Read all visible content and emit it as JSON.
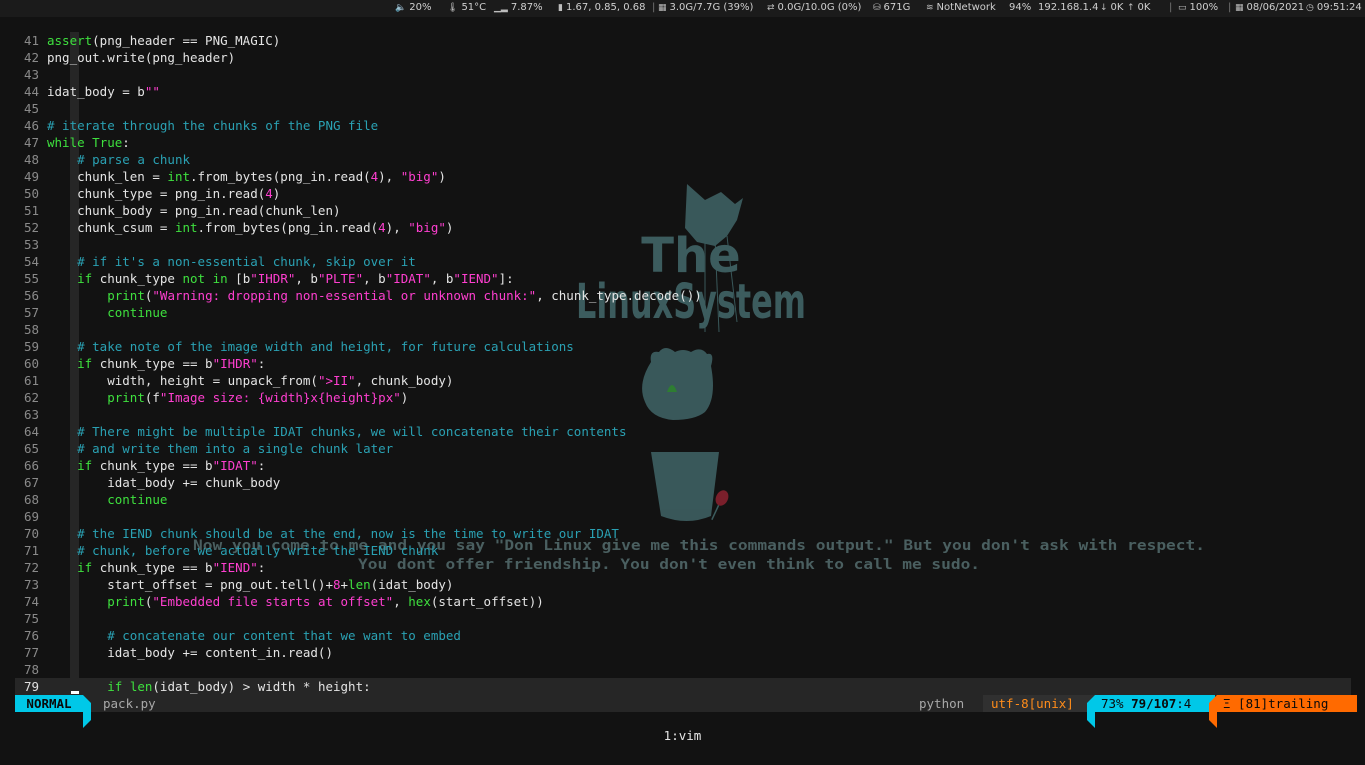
{
  "topbar": {
    "volume": "20%",
    "temperature": "51°C",
    "cpu": "7.87%",
    "load": "1.67, 0.85, 0.68",
    "memory": "3.0G/7.7G (39%)",
    "swap": "0.0G/10.0G (0%)",
    "disk": "671G",
    "network_name": "NotNetwork",
    "wifi_strength": "94%",
    "ip": "192.168.1.4",
    "down": "0K",
    "up": "0K",
    "battery": "100%",
    "date": "08/06/2021",
    "time": "09:51:24"
  },
  "editor": {
    "lines": [
      {
        "n": "41",
        "code": "<span class=\"t-bi\">assert</span>(png_header == PNG_MAGIC)"
      },
      {
        "n": "42",
        "code": "png_out.write(png_header)"
      },
      {
        "n": "43",
        "code": ""
      },
      {
        "n": "44",
        "code": "idat_body = b<span class=\"t-str\">\"\"</span>"
      },
      {
        "n": "45",
        "code": ""
      },
      {
        "n": "46",
        "code": "<span class=\"t-com\"># iterate through the chunks of the PNG file</span>"
      },
      {
        "n": "47",
        "code": "<span class=\"t-kw\">while</span> <span class=\"t-kw\">True</span>:"
      },
      {
        "n": "48",
        "code": "    <span class=\"t-com\"># parse a chunk</span>"
      },
      {
        "n": "49",
        "code": "    chunk_len = <span class=\"t-bi\">int</span>.from_bytes(png_in.read(<span class=\"t-num\">4</span>), <span class=\"t-str\">\"big\"</span>)"
      },
      {
        "n": "50",
        "code": "    chunk_type = png_in.read(<span class=\"t-num\">4</span>)"
      },
      {
        "n": "51",
        "code": "    chunk_body = png_in.read(chunk_len)"
      },
      {
        "n": "52",
        "code": "    chunk_csum = <span class=\"t-bi\">int</span>.from_bytes(png_in.read(<span class=\"t-num\">4</span>), <span class=\"t-str\">\"big\"</span>)"
      },
      {
        "n": "53",
        "code": ""
      },
      {
        "n": "54",
        "code": "    <span class=\"t-com\"># if it's a non-essential chunk, skip over it</span>"
      },
      {
        "n": "55",
        "code": "    <span class=\"t-kw\">if</span> chunk_type <span class=\"t-kw\">not in</span> [b<span class=\"t-str\">\"IHDR\"</span>, b<span class=\"t-str\">\"PLTE\"</span>, b<span class=\"t-str\">\"IDAT\"</span>, b<span class=\"t-str\">\"IEND\"</span>]:"
      },
      {
        "n": "56",
        "code": "        <span class=\"t-bi\">print</span>(<span class=\"t-str\">\"Warning: dropping non-essential or unknown chunk:\"</span>, chunk_type.decode())"
      },
      {
        "n": "57",
        "code": "        <span class=\"t-kw\">continue</span>"
      },
      {
        "n": "58",
        "code": ""
      },
      {
        "n": "59",
        "code": "    <span class=\"t-com\"># take note of the image width and height, for future calculations</span>"
      },
      {
        "n": "60",
        "code": "    <span class=\"t-kw\">if</span> chunk_type == b<span class=\"t-str\">\"IHDR\"</span>:"
      },
      {
        "n": "61",
        "code": "        width, height = unpack_from(<span class=\"t-str\">\"&gt;II\"</span>, chunk_body)"
      },
      {
        "n": "62",
        "code": "        <span class=\"t-bi\">print</span>(f<span class=\"t-str\">\"Image size: {width}x{height}px\"</span>)"
      },
      {
        "n": "63",
        "code": ""
      },
      {
        "n": "64",
        "code": "    <span class=\"t-com\"># There might be multiple IDAT chunks, we will concatenate their contents</span>"
      },
      {
        "n": "65",
        "code": "    <span class=\"t-com\"># and write them into a single chunk later</span>"
      },
      {
        "n": "66",
        "code": "    <span class=\"t-kw\">if</span> chunk_type == b<span class=\"t-str\">\"IDAT\"</span>:"
      },
      {
        "n": "67",
        "code": "        idat_body += chunk_body"
      },
      {
        "n": "68",
        "code": "        <span class=\"t-kw\">continue</span>"
      },
      {
        "n": "69",
        "code": ""
      },
      {
        "n": "70",
        "code": "    <span class=\"t-com\"># the IEND chunk should be at the end, now is the time to write our IDAT</span>"
      },
      {
        "n": "71",
        "code": "    <span class=\"t-com\"># chunk, before we actually write the IEND chunk</span>"
      },
      {
        "n": "72",
        "code": "    <span class=\"t-kw\">if</span> chunk_type == b<span class=\"t-str\">\"IEND\"</span>:"
      },
      {
        "n": "73",
        "code": "        start_offset = png_out.tell()+<span class=\"t-num\">8</span>+<span class=\"t-bi\">len</span>(idat_body)"
      },
      {
        "n": "74",
        "code": "        <span class=\"t-bi\">print</span>(<span class=\"t-str\">\"Embedded file starts at offset\"</span>, <span class=\"t-bi\">hex</span>(start_offset))"
      },
      {
        "n": "75",
        "code": ""
      },
      {
        "n": "76",
        "code": "        <span class=\"t-com\"># concatenate our content that we want to embed</span>"
      },
      {
        "n": "77",
        "code": "        idat_body += content_in.read()"
      },
      {
        "n": "78",
        "code": ""
      },
      {
        "n": "79",
        "code": "        <span class=\"t-kw\">if</span> <span class=\"t-bi\">len</span>(idat_body) &gt; width * height:",
        "current": true
      }
    ]
  },
  "wallpaper": {
    "logo_line1": "The",
    "logo_line2": "LinuxSystem",
    "quote_line1": "Now you come to me and you say \"Don Linux give me this commands output.\" But you don't ask with respect.",
    "quote_line2": "You dont offer friendship. You don't even think to call me sudo."
  },
  "statusline": {
    "mode": "NORMAL",
    "filename": "pack.py",
    "filetype": "python",
    "encoding": "utf-8[unix]",
    "percent": "73%",
    "position": "79/107",
    "column": ":4",
    "warning": "Ξ [81]trailing"
  },
  "tmux": {
    "window": "1:vim"
  },
  "colors": {
    "mode_bg": "#00c8e8",
    "warning_bg": "#ff6a00",
    "keyword": "#3ee03e",
    "string": "#ff3fd0",
    "comment": "#2aa1b3"
  }
}
